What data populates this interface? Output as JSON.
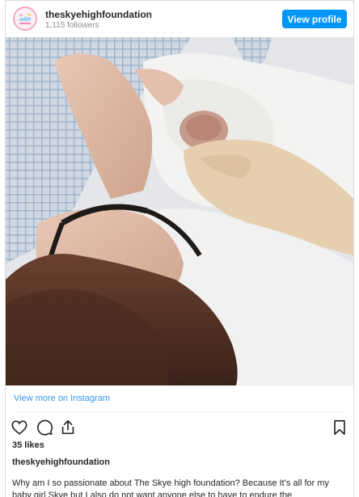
{
  "header": {
    "account_name": "theskyehighfoundation",
    "followers": "1,115 followers",
    "view_profile_label": "View profile",
    "avatar_logo_text": "Skye High"
  },
  "post": {
    "view_more_label": "View more on Instagram",
    "likes": "35 likes",
    "caption_author": "theskyehighfoundation",
    "caption_text": "Why am I so passionate about The Skye high foundation? Because It's all for my baby girl Skye but I also do not want anyone else to have to endure the"
  },
  "colors": {
    "accent": "#0095f6",
    "link": "#3897f0",
    "text": "#262626",
    "muted": "#8e8e8e",
    "border": "#dbdbdb"
  },
  "icons": [
    "heart-icon",
    "comment-icon",
    "share-icon",
    "bookmark-icon"
  ]
}
